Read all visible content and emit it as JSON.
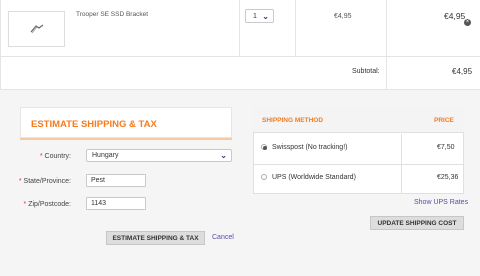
{
  "cart": {
    "item": {
      "name": "Trooper SE SSD Bracket",
      "quantity": "1",
      "unit_price": "€4,95",
      "line_total": "€4,95",
      "image_icon": "bracket-icon",
      "remove_icon": "remove-icon"
    },
    "subtotal_label": "Subtotal:",
    "subtotal_value": "€4,95"
  },
  "estimate": {
    "title": "ESTIMATE SHIPPING & TAX",
    "required_marker": "*",
    "country_label": "Country:",
    "country_value": "Hungary",
    "state_label": "State/Province:",
    "state_value": "Pest",
    "zip_label": "Zip/Postcode:",
    "zip_value": "1143",
    "estimate_button": "ESTIMATE SHIPPING & TAX",
    "cancel_link": "Cancel"
  },
  "shipping": {
    "method_header": "SHIPPING METHOD",
    "price_header": "PRICE",
    "options": [
      {
        "label": "Swisspost (No tracking!)",
        "price": "€7,50",
        "selected": true
      },
      {
        "label": "UPS (Worldwide Standard)",
        "price": "€25,36",
        "selected": false
      }
    ],
    "show_ups_rates": "Show UPS Rates",
    "update_button": "UPDATE SHIPPING COST"
  },
  "colors": {
    "accent": "#f47b20",
    "link": "#5b4aa8",
    "required": "#e3342f"
  }
}
